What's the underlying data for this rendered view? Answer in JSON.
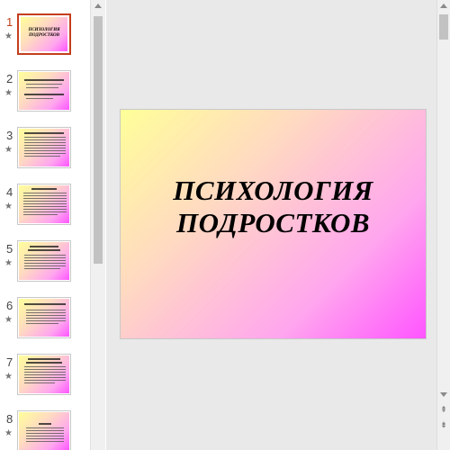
{
  "thumbnails": [
    {
      "number": "1",
      "active": true,
      "title": "ПСИХОЛОГИЯ ПОДРОСТКОВ"
    },
    {
      "number": "2",
      "active": false
    },
    {
      "number": "3",
      "active": false
    },
    {
      "number": "4",
      "active": false
    },
    {
      "number": "5",
      "active": false
    },
    {
      "number": "6",
      "active": false
    },
    {
      "number": "7",
      "active": false
    },
    {
      "number": "8",
      "active": false
    }
  ],
  "thumbnail_star": "★",
  "slide": {
    "title_line1": "ПСИХОЛОГИЯ",
    "title_line2": "ПОДРОСТКОВ"
  },
  "nav": {
    "prev_slide_glyph": "⇞",
    "next_slide_glyph": "⇟"
  },
  "colors": {
    "accent": "#c43e1c",
    "slide_gradient": [
      "#ffff99",
      "#ffd9c2",
      "#ffa6ee",
      "#ff55ff"
    ]
  }
}
